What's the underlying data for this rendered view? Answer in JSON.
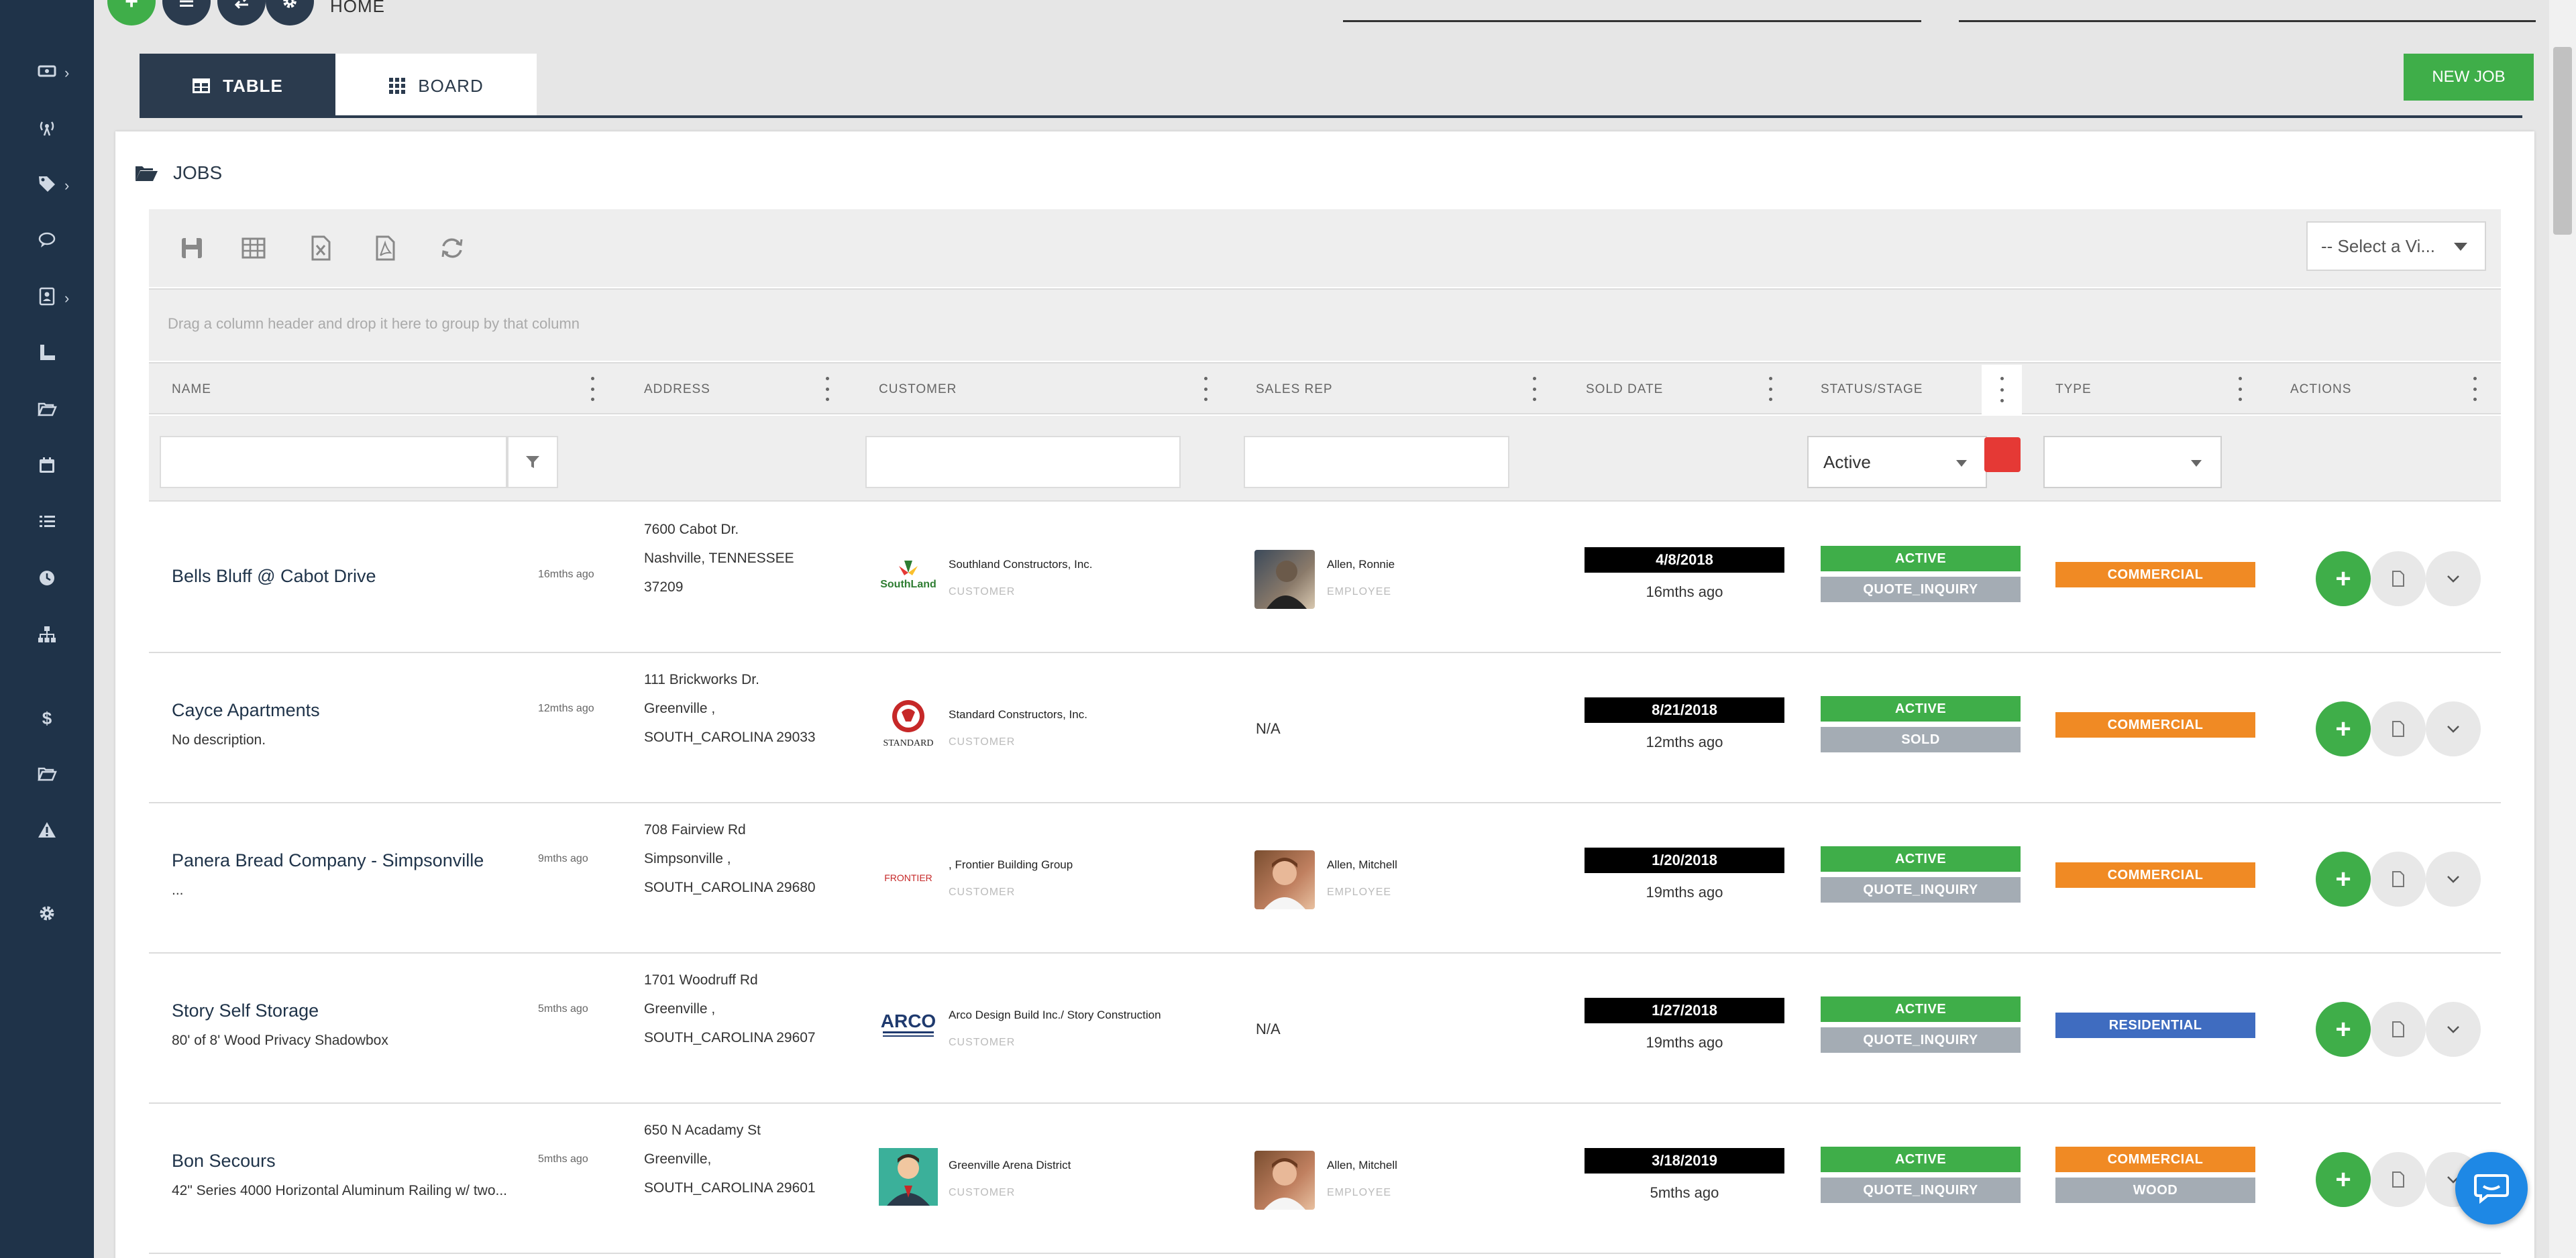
{
  "header": {
    "title": "HOME",
    "actions": [
      "add-icon",
      "menu-icon",
      "swap-icon",
      "settings-icon"
    ]
  },
  "sidebar": {
    "items": [
      {
        "icon": "money-icon",
        "has_submenu": true
      },
      {
        "icon": "broadcast-icon",
        "has_submenu": false
      },
      {
        "icon": "tag-icon",
        "has_submenu": true
      },
      {
        "icon": "chat-icon",
        "has_submenu": false
      },
      {
        "icon": "contacts-icon",
        "has_submenu": true
      },
      {
        "icon": "ruler-icon",
        "has_submenu": false
      },
      {
        "icon": "folder-open-icon",
        "has_submenu": false
      },
      {
        "icon": "calendar-icon",
        "has_submenu": false
      },
      {
        "icon": "list-icon",
        "has_submenu": false
      },
      {
        "icon": "clock-icon",
        "has_submenu": false
      },
      {
        "icon": "org-chart-icon",
        "has_submenu": false
      },
      {
        "icon": "dollar-icon",
        "has_submenu": false
      },
      {
        "icon": "folder-icon",
        "has_submenu": false
      },
      {
        "icon": "warning-icon",
        "has_submenu": false
      },
      {
        "icon": "settings-icon",
        "has_submenu": false
      }
    ]
  },
  "tabs": {
    "table": "TABLE",
    "board": "BOARD"
  },
  "new_job_label": "NEW JOB",
  "jobs": {
    "title": "JOBS",
    "toolbar_icons": [
      "save-icon",
      "table-icon",
      "excel-icon",
      "pdf-icon",
      "refresh-icon"
    ],
    "view_select": "-- Select a Vi...",
    "group_hint": "Drag a column header and drop it here to group by that column",
    "columns": {
      "name": "NAME",
      "address": "ADDRESS",
      "customer": "CUSTOMER",
      "sales_rep": "SALES REP",
      "sold_date": "SOLD DATE",
      "status": "STATUS/STAGE",
      "type": "TYPE",
      "actions": "ACTIONS"
    },
    "filters": {
      "name": "",
      "customer": "",
      "sales_rep": "",
      "status": "Active",
      "type": ""
    },
    "rows": [
      {
        "name": "Bells Bluff @ Cabot Drive",
        "description": "",
        "ago": "16mths ago",
        "address": [
          "7600 Cabot Dr.",
          "Nashville, TENNESSEE",
          "37209"
        ],
        "customer": "Southland Constructors, Inc.",
        "customer_role": "CUSTOMER",
        "customer_logo_text": "SouthLand",
        "sales_rep": "Allen, Ronnie",
        "sales_rep_role": "EMPLOYEE",
        "sold_date": "4/8/2018",
        "sold_ago": "16mths ago",
        "status": "ACTIVE",
        "stage": "QUOTE_INQUIRY",
        "type": "COMMERCIAL",
        "type2": ""
      },
      {
        "name": "Cayce Apartments",
        "description": "No description.",
        "ago": "12mths ago",
        "address": [
          "111 Brickworks Dr.",
          "Greenville ,",
          "SOUTH_CAROLINA 29033"
        ],
        "customer": "Standard Constructors, Inc.",
        "customer_role": "CUSTOMER",
        "customer_logo_text": "STANDARD",
        "sales_rep": "N/A",
        "sales_rep_role": "",
        "sold_date": "8/21/2018",
        "sold_ago": "12mths ago",
        "status": "ACTIVE",
        "stage": "SOLD",
        "type": "COMMERCIAL",
        "type2": ""
      },
      {
        "name": "Panera Bread Company - Simpsonville",
        "description": "...",
        "ago": "9mths ago",
        "address": [
          "708 Fairview Rd",
          "Simpsonville ,",
          "SOUTH_CAROLINA 29680"
        ],
        "customer": ", Frontier Building Group",
        "customer_role": "CUSTOMER",
        "customer_logo_text": "FRONTIER",
        "sales_rep": "Allen, Mitchell",
        "sales_rep_role": "EMPLOYEE",
        "sold_date": "1/20/2018",
        "sold_ago": "19mths ago",
        "status": "ACTIVE",
        "stage": "QUOTE_INQUIRY",
        "type": "COMMERCIAL",
        "type2": ""
      },
      {
        "name": "Story Self Storage",
        "description": "80' of 8' Wood Privacy Shadowbox",
        "ago": "5mths ago",
        "address": [
          "1701 Woodruff Rd",
          "Greenville ,",
          "SOUTH_CAROLINA 29607"
        ],
        "customer": "Arco Design Build Inc./ Story Construction",
        "customer_role": "CUSTOMER",
        "customer_logo_text": "ARCO",
        "sales_rep": "N/A",
        "sales_rep_role": "",
        "sold_date": "1/27/2018",
        "sold_ago": "19mths ago",
        "status": "ACTIVE",
        "stage": "QUOTE_INQUIRY",
        "type": "RESIDENTIAL",
        "type2": ""
      },
      {
        "name": "Bon Secours",
        "description": "42\" Series 4000 Horizontal Aluminum Railing w/ two...",
        "ago": "5mths ago",
        "address": [
          "650 N Acadamy St",
          "Greenville,",
          "SOUTH_CAROLINA 29601"
        ],
        "customer": "Greenville Arena District",
        "customer_role": "CUSTOMER",
        "customer_logo_text": "",
        "sales_rep": "Allen, Mitchell",
        "sales_rep_role": "EMPLOYEE",
        "sold_date": "3/18/2019",
        "sold_ago": "5mths ago",
        "status": "ACTIVE",
        "stage": "QUOTE_INQUIRY",
        "type": "COMMERCIAL",
        "type2": "WOOD"
      }
    ]
  },
  "colors": {
    "sidebar": "#1f3349",
    "green": "#3fae49",
    "grey_badge": "#a4acb4",
    "orange": "#f08a24",
    "blue": "#3f6cc0",
    "red": "#e53935"
  }
}
